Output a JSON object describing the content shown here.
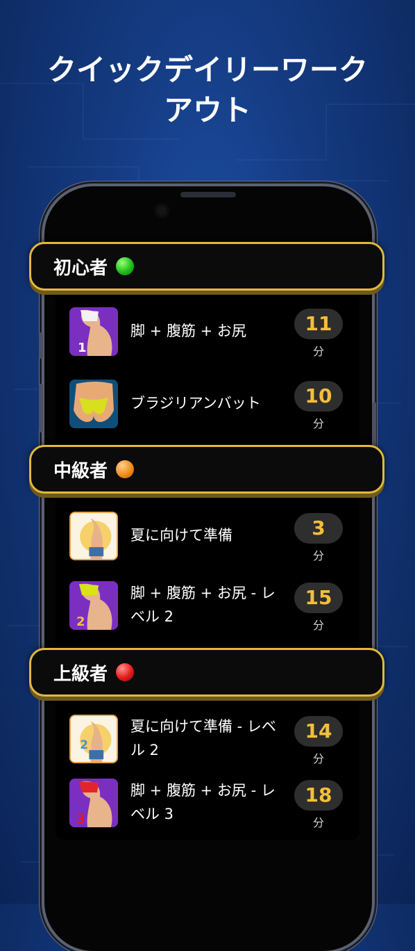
{
  "headline": {
    "line1": "クイックデイリーワーク",
    "line2": "アウト"
  },
  "levels": [
    {
      "title": "初心者",
      "dot_color": "#22c01c",
      "workouts": [
        {
          "title": "脚 + 腹筋 + お尻",
          "duration": "11",
          "unit": "分",
          "badge": "1"
        },
        {
          "title": "ブラジリアンバット",
          "duration": "10",
          "unit": "分",
          "badge": ""
        }
      ]
    },
    {
      "title": "中級者",
      "dot_color": "#f08d1c",
      "workouts": [
        {
          "title": "夏に向けて準備",
          "duration": "3",
          "unit": "分",
          "badge": ""
        },
        {
          "title": "脚 + 腹筋 + お尻 - レベル 2",
          "duration": "15",
          "unit": "分",
          "badge": "2"
        }
      ]
    },
    {
      "title": "上級者",
      "dot_color": "#e21a1a",
      "workouts": [
        {
          "title": "夏に向けて準備 - レベル 2",
          "duration": "14",
          "unit": "分",
          "badge": "2"
        },
        {
          "title": "脚 + 腹筋 + お尻 - レベル 3",
          "duration": "18",
          "unit": "分",
          "badge": "3"
        }
      ]
    }
  ],
  "colors": {
    "accent_gold": "#e2b93a",
    "duration_text": "#f2bf3a",
    "background": "#143a80"
  }
}
